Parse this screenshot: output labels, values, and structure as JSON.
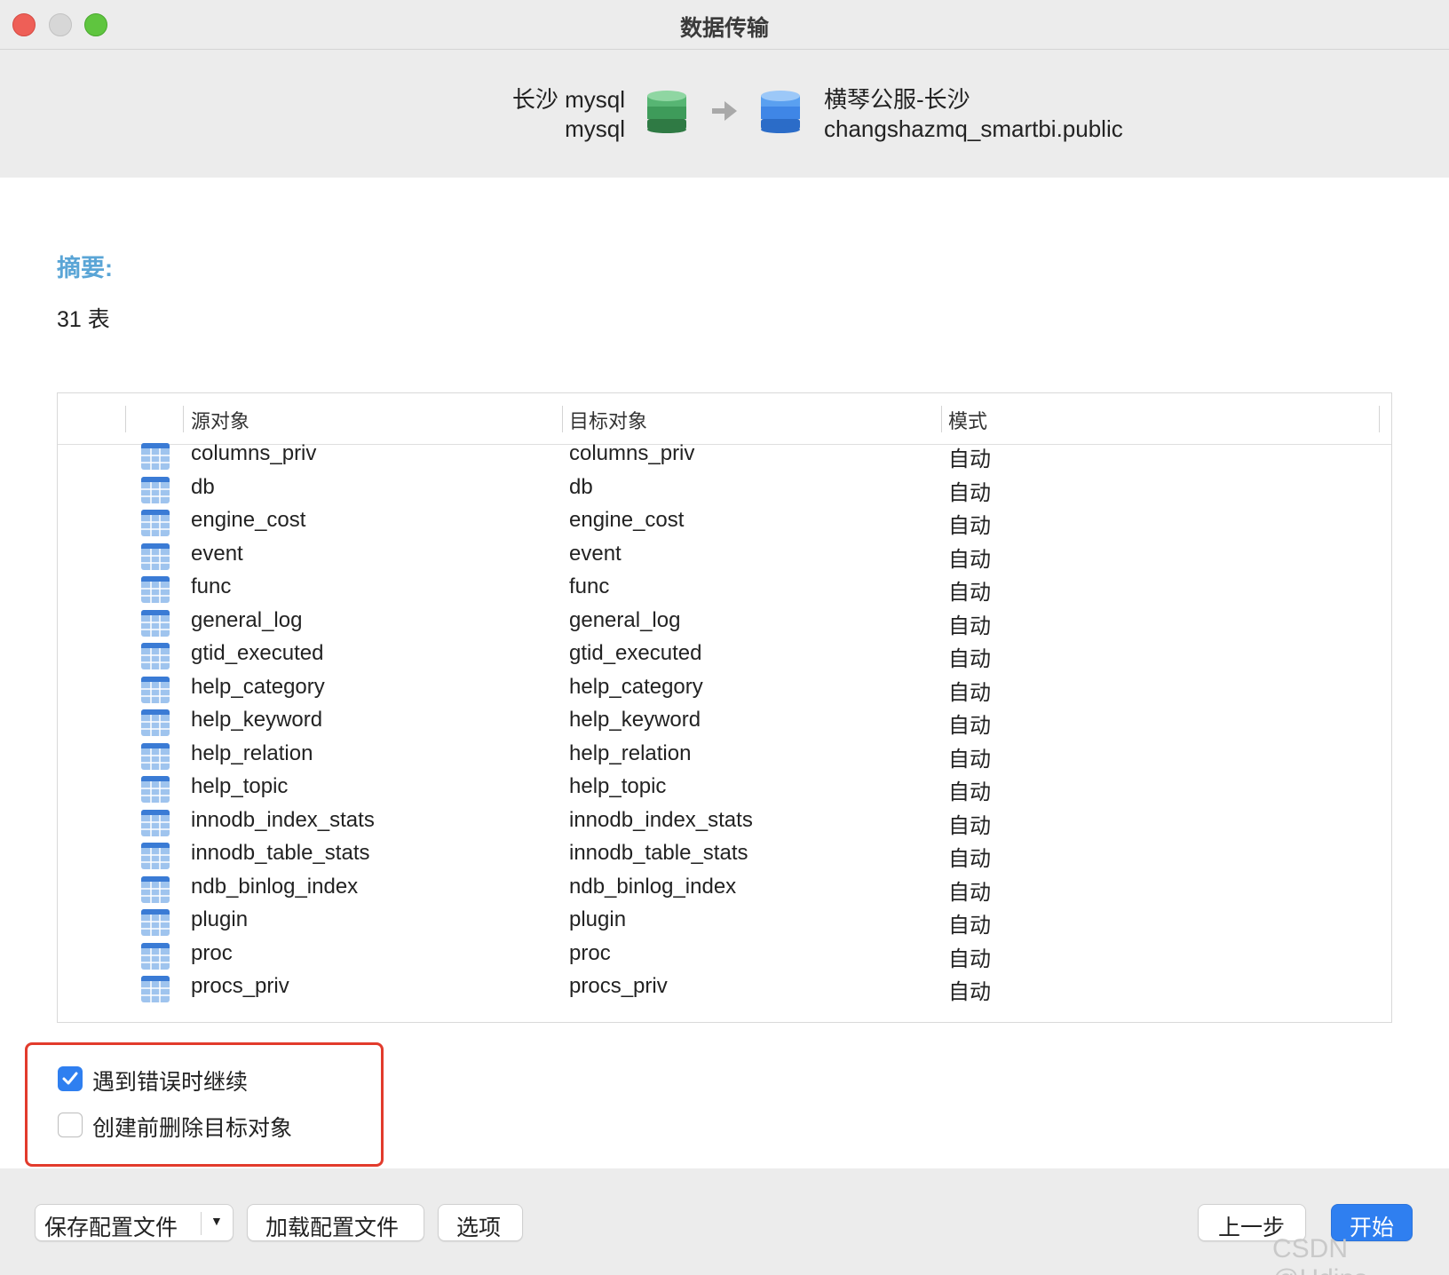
{
  "window": {
    "title": "数据传输"
  },
  "transfer": {
    "source": {
      "connection": "长沙 mysql",
      "database": "mysql"
    },
    "target": {
      "connection": "横琴公服-长沙",
      "database": "changshazmq_smartbi.public"
    }
  },
  "summary": {
    "title": "摘要:",
    "count": "31 表"
  },
  "table": {
    "headers": {
      "source": "源对象",
      "target": "目标对象",
      "mode": "模式"
    },
    "rows": [
      {
        "source": "columns_priv",
        "target": "columns_priv",
        "mode": "自动"
      },
      {
        "source": "db",
        "target": "db",
        "mode": "自动"
      },
      {
        "source": "engine_cost",
        "target": "engine_cost",
        "mode": "自动"
      },
      {
        "source": "event",
        "target": "event",
        "mode": "自动"
      },
      {
        "source": "func",
        "target": "func",
        "mode": "自动"
      },
      {
        "source": "general_log",
        "target": "general_log",
        "mode": "自动"
      },
      {
        "source": "gtid_executed",
        "target": "gtid_executed",
        "mode": "自动"
      },
      {
        "source": "help_category",
        "target": "help_category",
        "mode": "自动"
      },
      {
        "source": "help_keyword",
        "target": "help_keyword",
        "mode": "自动"
      },
      {
        "source": "help_relation",
        "target": "help_relation",
        "mode": "自动"
      },
      {
        "source": "help_topic",
        "target": "help_topic",
        "mode": "自动"
      },
      {
        "source": "innodb_index_stats",
        "target": "innodb_index_stats",
        "mode": "自动"
      },
      {
        "source": "innodb_table_stats",
        "target": "innodb_table_stats",
        "mode": "自动"
      },
      {
        "source": "ndb_binlog_index",
        "target": "ndb_binlog_index",
        "mode": "自动"
      },
      {
        "source": "plugin",
        "target": "plugin",
        "mode": "自动"
      },
      {
        "source": "proc",
        "target": "proc",
        "mode": "自动"
      },
      {
        "source": "procs_priv",
        "target": "procs_priv",
        "mode": "自动"
      }
    ]
  },
  "options": {
    "continue_on_error": {
      "label": "遇到错误时继续",
      "checked": true
    },
    "drop_before_create": {
      "label": "创建前删除目标对象",
      "checked": false
    }
  },
  "footer": {
    "save_profile": "保存配置文件",
    "load_profile": "加载配置文件",
    "options": "选项",
    "back": "上一步",
    "start": "开始"
  },
  "watermark": "CSDN @Hdjns",
  "colors": {
    "accent": "#2f7ff0",
    "summary_title": "#5aa5d6",
    "highlight_border": "#e23b2c",
    "source_db": "#3e9b5a",
    "target_db": "#3f86e6"
  }
}
